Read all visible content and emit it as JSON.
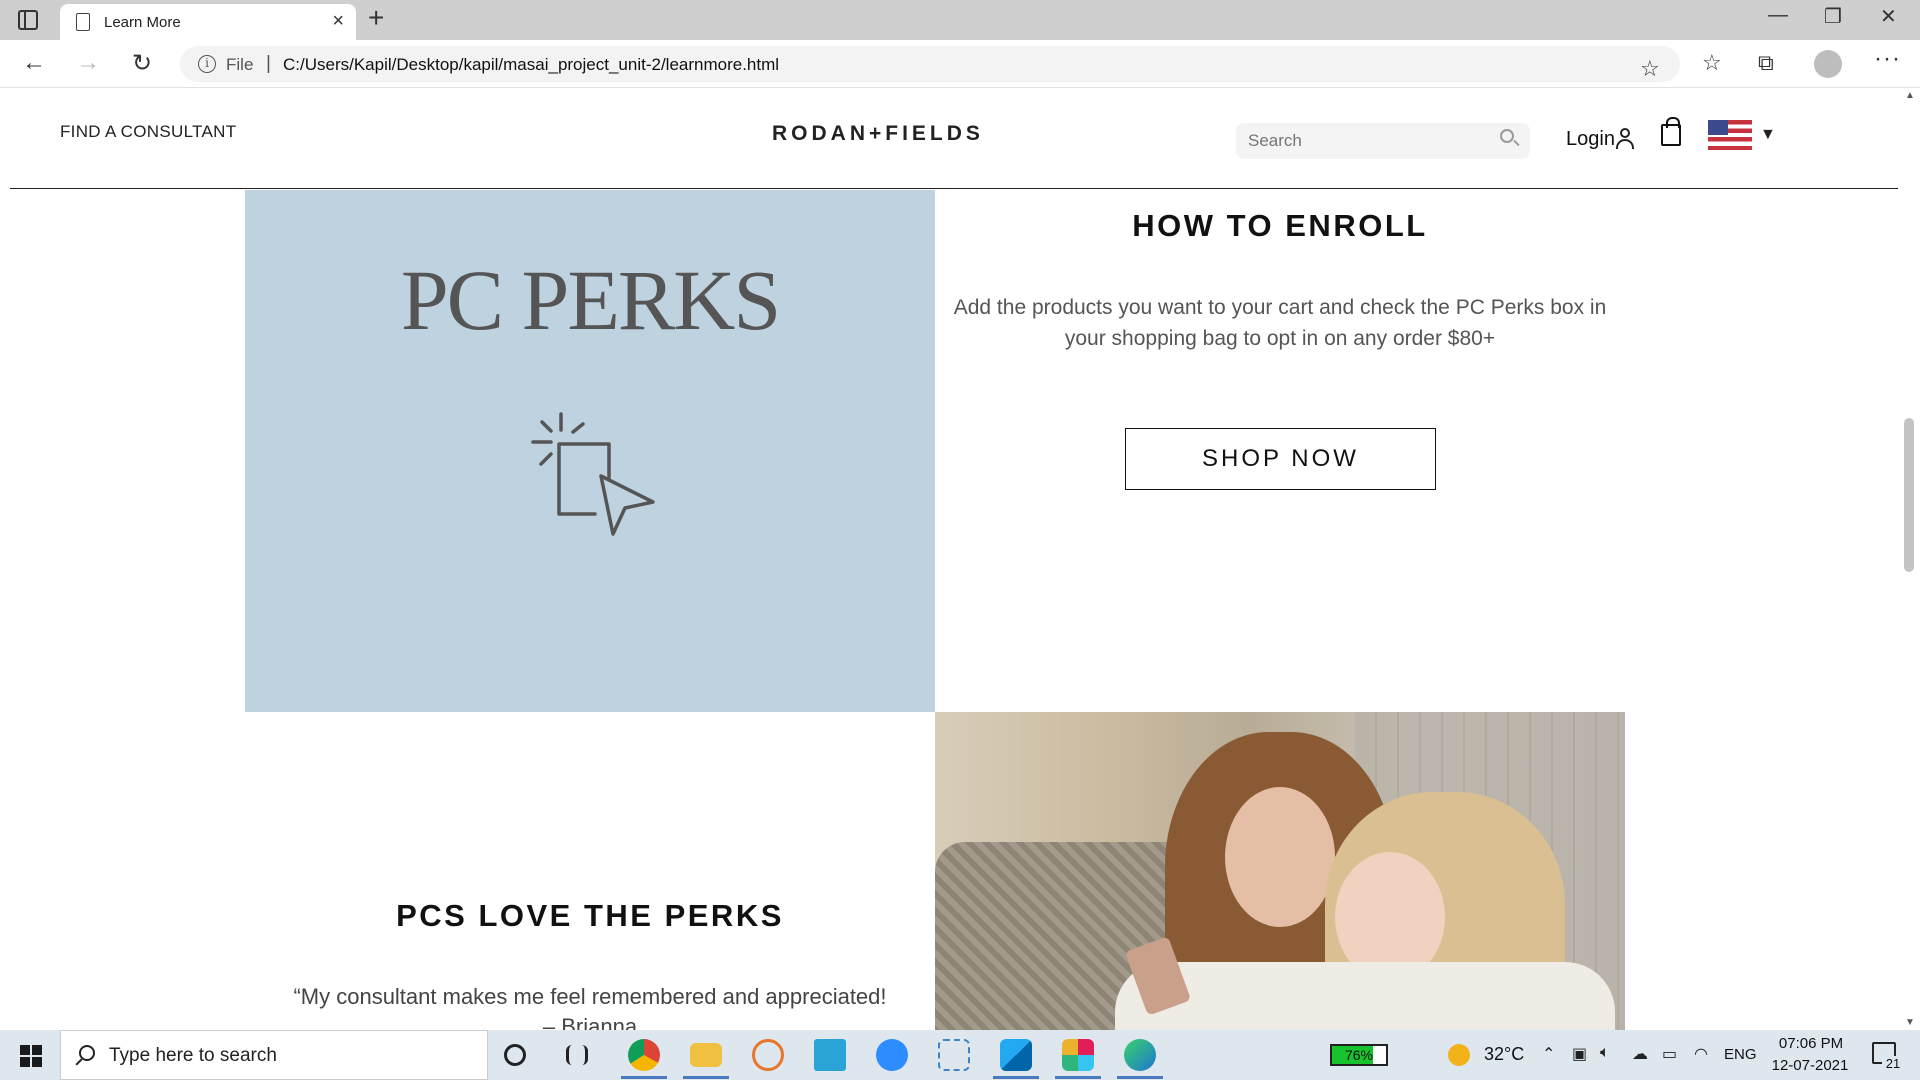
{
  "browser": {
    "tab_title": "Learn More",
    "address_prefix": "File",
    "url": "C:/Users/Kapil/Desktop/kapil/masai_project_unit-2/learnmore.html"
  },
  "header": {
    "find_consultant": "FIND A CONSULTANT",
    "brand": "RODAN+FIELDS",
    "search_placeholder": "Search",
    "login_label": "Login"
  },
  "enroll": {
    "panel_title": "PC PERKS",
    "heading": "HOW TO ENROLL",
    "text": "Add the products you want to your cart and check the PC Perks box in your shopping bag to opt in on any order $80+",
    "button_label": "SHOP NOW"
  },
  "love": {
    "heading": "PCS LOVE THE PERKS",
    "quote": "“My consultant makes me feel remembered and appreciated!",
    "author": "– Brianna"
  },
  "taskbar": {
    "search_placeholder": "Type here to search",
    "battery": "76%",
    "battery_level": 0.76,
    "temperature": "32°C",
    "language": "ENG",
    "time": "07:06 PM",
    "date": "12-07-2021",
    "notifications": "21"
  }
}
